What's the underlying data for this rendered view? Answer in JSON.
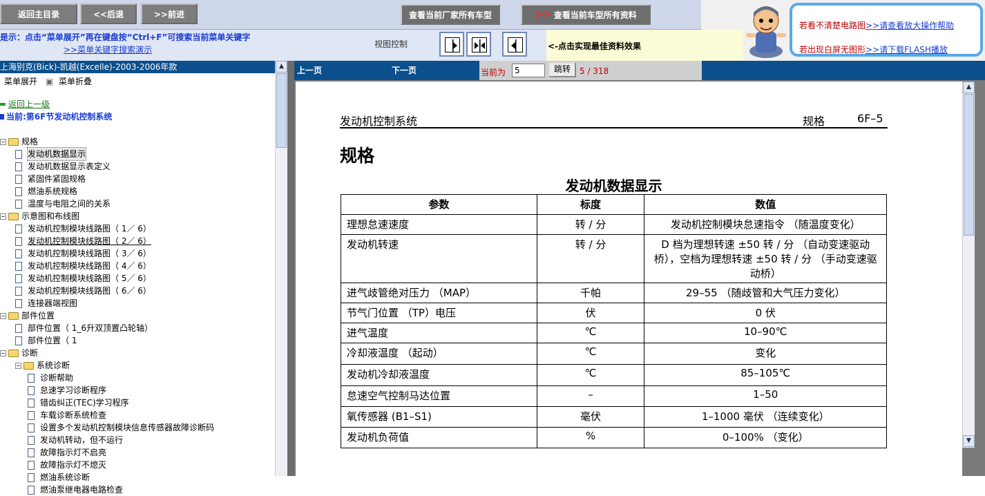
{
  "toolbar": {
    "home": "返回主目录",
    "back": "<<后退",
    "forward": ">>前进",
    "all_models": "查看当前厂家所有车型",
    "all_docs_chev": ">>",
    "all_docs": "查看当前车型所有资料"
  },
  "hint": {
    "line1": "是示：点击“菜单展开”再在键盘按“Ctrl+F”可搜索当前菜单关键字",
    "line2": ">>菜单关键字搜索演示",
    "view_control": "视图控制",
    "best_effect": "<-点击实现最佳资料效果"
  },
  "help": {
    "line1_text": "若看不清楚电路图",
    "line1_link": ">>请查看放大操作帮助",
    "line2_text": "若出现白屏无图形",
    "line2_link": ">>请下载FLASH播放"
  },
  "left": {
    "title": "上海别克(Bick)-凯越(Excelle)-2003-2006年款",
    "expand": "菜单展开",
    "collapse": "菜单折叠",
    "back_up": "返回上一级",
    "current": "当前:第6F节发动机控制系统",
    "tree": [
      "规格",
      "发动机数据显示",
      "发动机数据显示表定义",
      "紧固件紧固规格",
      "燃油系统规格",
      "温度与电阻之间的关系",
      "示意图和布线图",
      "发动机控制模块线路图（ 1／  6）",
      "发动机控制模块线路图（ 2／  6）",
      "发动机控制模块线路图（ 3／  6）",
      "发动机控制模块线路图（ 4／  6）",
      "发动机控制模块线路图（ 5／  6）",
      "发动机控制模块线路图（ 6／  6）",
      "连接器端视图",
      "部件位置",
      "部件位置（ 1_6升双顶置凸轮轴）",
      "部件位置（ 1",
      "诊断",
      "系统诊断",
      "诊断帮助",
      "怠速学习诊断程序",
      "错齿纠正(TEC)学习程序",
      "车载诊断系统检查",
      "设置多个发动机控制模块信息传感器故障诊断码",
      "发动机转动，但不运行",
      "故障指示灯不启亮",
      "故障指示灯不熄灭",
      "燃油系统诊断",
      "燃油泵继电器电路检查"
    ]
  },
  "pager": {
    "prev": "上一页",
    "next": "下一页",
    "current_label": "当前为",
    "current_value": "5",
    "jump": "跳转",
    "count": "5 / 318"
  },
  "doc": {
    "header_left": "发动机控制系统",
    "header_mid": "规格",
    "header_right": "6F–5",
    "section_title": "规格",
    "table_title": "发动机数据显示",
    "columns": [
      "参数",
      "标度",
      "数值"
    ],
    "rows": [
      [
        "理想怠速速度",
        "转 / 分",
        "发动机控制模块怠速指令 （随温度变化）"
      ],
      [
        "发动机转速",
        "转 / 分",
        "D 档为理想转速 ±50 转 / 分 （自动变速驱动桥），空档为理想转速 ±50 转 / 分 （手动变速驱动桥）"
      ],
      [
        "进气歧管绝对压力 （MAP）",
        "千帕",
        "29–55 （随歧管和大气压力变化）"
      ],
      [
        "节气门位置 （TP）电压",
        "伏",
        "0 伏"
      ],
      [
        "进气温度",
        "℃",
        "10–90℃"
      ],
      [
        "冷却液温度 （起动）",
        "℃",
        "变化"
      ],
      [
        "发动机冷却液温度",
        "℃",
        "85–105℃"
      ],
      [
        "怠速空气控制马达位置",
        "–",
        "1–50"
      ],
      [
        "氧传感器 (B1–S1)",
        "毫伏",
        "1–1000 毫伏 （连续变化）"
      ],
      [
        "发动机负荷值",
        "%",
        "0–100% （变化）"
      ]
    ]
  }
}
